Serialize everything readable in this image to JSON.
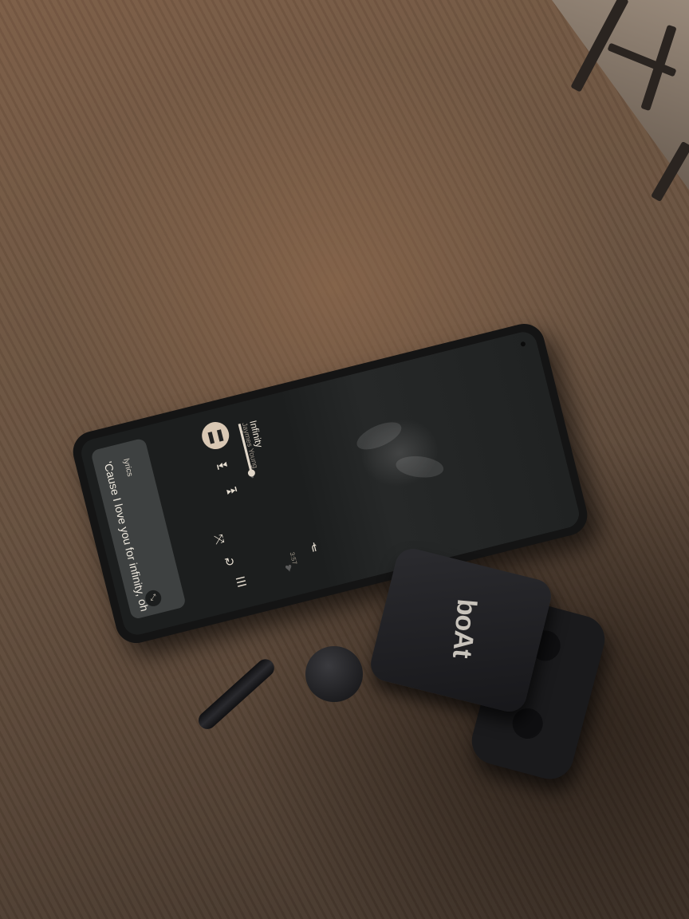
{
  "player": {
    "lyrics_label": "lyrics",
    "lyrics_line": "'Cause I love you for infinity, oh",
    "track_title": "Infinity",
    "artist": "Jaymes Young",
    "duration": "3:57"
  },
  "case": {
    "brand": "boAt"
  },
  "icons": [
    "pause-icon",
    "previous-icon",
    "next-icon",
    "shuffle-icon",
    "repeat-icon",
    "queue-icon",
    "heart-icon",
    "share-icon"
  ]
}
